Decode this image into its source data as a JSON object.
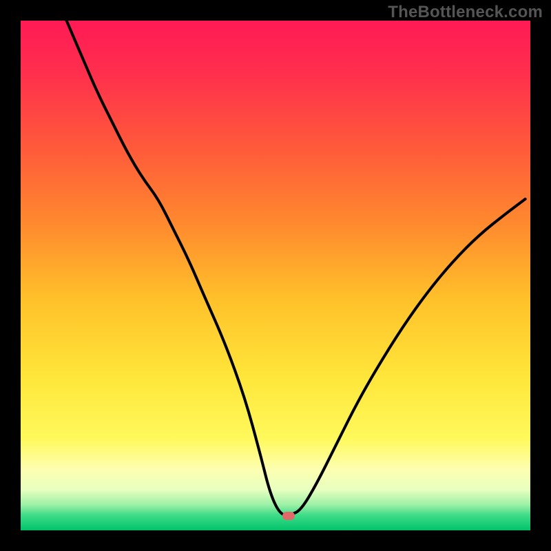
{
  "watermark": "TheBottleneck.com",
  "marker": {
    "x_pct": 52.5,
    "y_pct": 97.2,
    "color": "#e06a6a"
  },
  "gradient_stops": [
    {
      "offset": 0,
      "color": "#ff1a55"
    },
    {
      "offset": 10,
      "color": "#ff2e4d"
    },
    {
      "offset": 25,
      "color": "#ff5a3a"
    },
    {
      "offset": 40,
      "color": "#ff8a2e"
    },
    {
      "offset": 55,
      "color": "#ffc22a"
    },
    {
      "offset": 70,
      "color": "#ffe63a"
    },
    {
      "offset": 82,
      "color": "#fff95c"
    },
    {
      "offset": 88,
      "color": "#fdffb0"
    },
    {
      "offset": 92,
      "color": "#e8ffc0"
    },
    {
      "offset": 95,
      "color": "#9cf0a6"
    },
    {
      "offset": 97,
      "color": "#3fdc88"
    },
    {
      "offset": 100,
      "color": "#00c36b"
    }
  ],
  "chart_data": {
    "type": "line",
    "title": "",
    "xlabel": "",
    "ylabel": "",
    "xlim": [
      0,
      100
    ],
    "ylim": [
      0,
      100
    ],
    "series": [
      {
        "name": "bottleneck-curve",
        "x": [
          9,
          12,
          15,
          18,
          21,
          24,
          27,
          30,
          33,
          36,
          40,
          44,
          47,
          49,
          51,
          53,
          55,
          58,
          62,
          66,
          70,
          75,
          80,
          85,
          90,
          95,
          99
        ],
        "y": [
          100,
          93,
          86,
          80,
          74,
          69,
          65,
          59,
          53,
          46,
          37,
          26,
          15,
          7,
          3,
          3,
          4,
          9,
          17,
          25,
          32,
          40,
          47,
          53,
          58,
          62,
          65
        ]
      }
    ],
    "annotation": {
      "marker_x": 52.5,
      "marker_y": 3,
      "marker_color": "#e06a6a"
    }
  }
}
